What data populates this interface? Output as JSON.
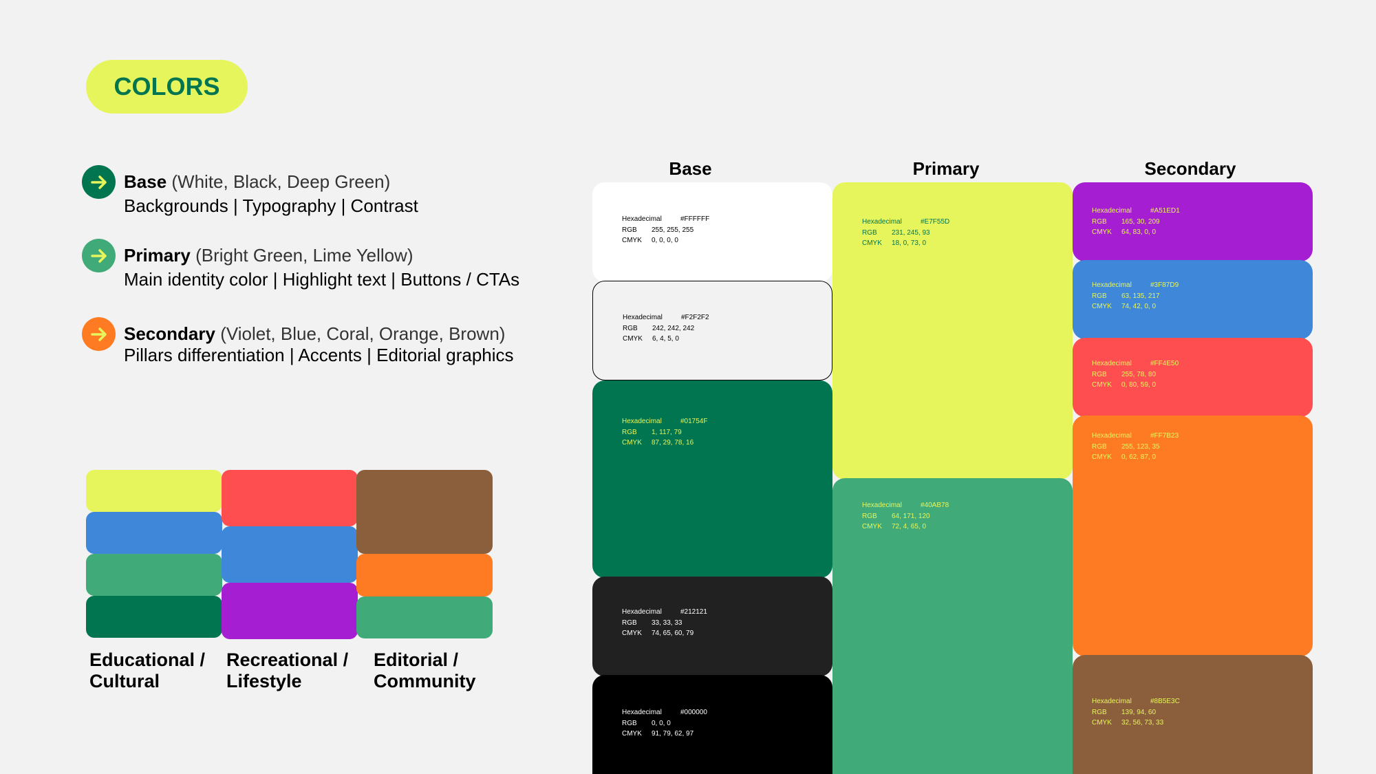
{
  "header": {
    "badge": "COLORS"
  },
  "legend": [
    {
      "title": "Base",
      "sub": "(White, Black, Deep Green)",
      "desc": "Backgrounds | Typography | Contrast",
      "icon": "arrow-right-icon",
      "color": "#01754F",
      "arrow": "#FFFFFF"
    },
    {
      "title": "Primary",
      "sub": "(Bright Green, Lime Yellow)",
      "desc": "Main identity color | Highlight text | Buttons / CTAs",
      "icon": "arrow-right-icon",
      "color": "#40AB78",
      "arrow": "#E7F55D"
    },
    {
      "title": "Secondary",
      "sub": "(Violet, Blue, Coral, Orange, Brown)",
      "desc": "Pillars differentiation | Accents | Editorial graphics",
      "icon": "arrow-right-icon",
      "color": "#FF7B23",
      "arrow": "#E7F55D"
    }
  ],
  "pillars": [
    {
      "label_line1": "Educational /",
      "label_line2": "Cultural"
    },
    {
      "label_line1": "Recreational /",
      "label_line2": "Lifestyle"
    },
    {
      "label_line1": "Editorial /",
      "label_line2": "Community"
    }
  ],
  "palette": {
    "columns": {
      "base": "Base",
      "primary": "Primary",
      "secondary": "Secondary"
    },
    "labels": {
      "hex": "Hexadecimal",
      "rgb": "RGB",
      "cmyk": "CMYK"
    },
    "base": [
      {
        "hex": "#FFFFFF",
        "rgb": "255, 255, 255",
        "cmyk": "0, 0, 0, 0",
        "text": "#000000"
      },
      {
        "hex": "#F2F2F2",
        "rgb": "242, 242, 242",
        "cmyk": "6, 4, 5, 0",
        "text": "#000000"
      },
      {
        "hex": "#01754F",
        "rgb": "1, 117, 79",
        "cmyk": "87, 29, 78, 16",
        "text": "#E7F55D"
      },
      {
        "hex": "#212121",
        "rgb": "33, 33, 33",
        "cmyk": "74, 65, 60, 79",
        "text": "#FFFFFF"
      },
      {
        "hex": "#000000",
        "rgb": "0, 0, 0",
        "cmyk": "91, 79, 62, 97",
        "text": "#FFFFFF"
      }
    ],
    "primary": [
      {
        "hex": "#E7F55D",
        "rgb": "231, 245, 93",
        "cmyk": "18, 0, 73, 0",
        "text": "#01754F"
      },
      {
        "hex": "#40AB78",
        "rgb": "64, 171, 120",
        "cmyk": "72, 4, 65, 0",
        "text": "#E7F55D"
      }
    ],
    "secondary": [
      {
        "hex": "#A51ED1",
        "rgb": "165, 30, 209",
        "cmyk": "64, 83, 0, 0",
        "text": "#E7F55D"
      },
      {
        "hex": "#3F87D9",
        "rgb": "63, 135, 217",
        "cmyk": "74, 42, 0, 0",
        "text": "#E7F55D"
      },
      {
        "hex": "#FF4E50",
        "rgb": "255, 78, 80",
        "cmyk": "0, 80, 59, 0",
        "text": "#E7F55D"
      },
      {
        "hex": "#FF7B23",
        "rgb": "255, 123, 35",
        "cmyk": "0, 62, 87, 0",
        "text": "#E7F55D"
      },
      {
        "hex": "#8B5E3C",
        "rgb": "139, 94, 60",
        "cmyk": "32, 56, 73, 33",
        "text": "#E7F55D"
      }
    ]
  }
}
